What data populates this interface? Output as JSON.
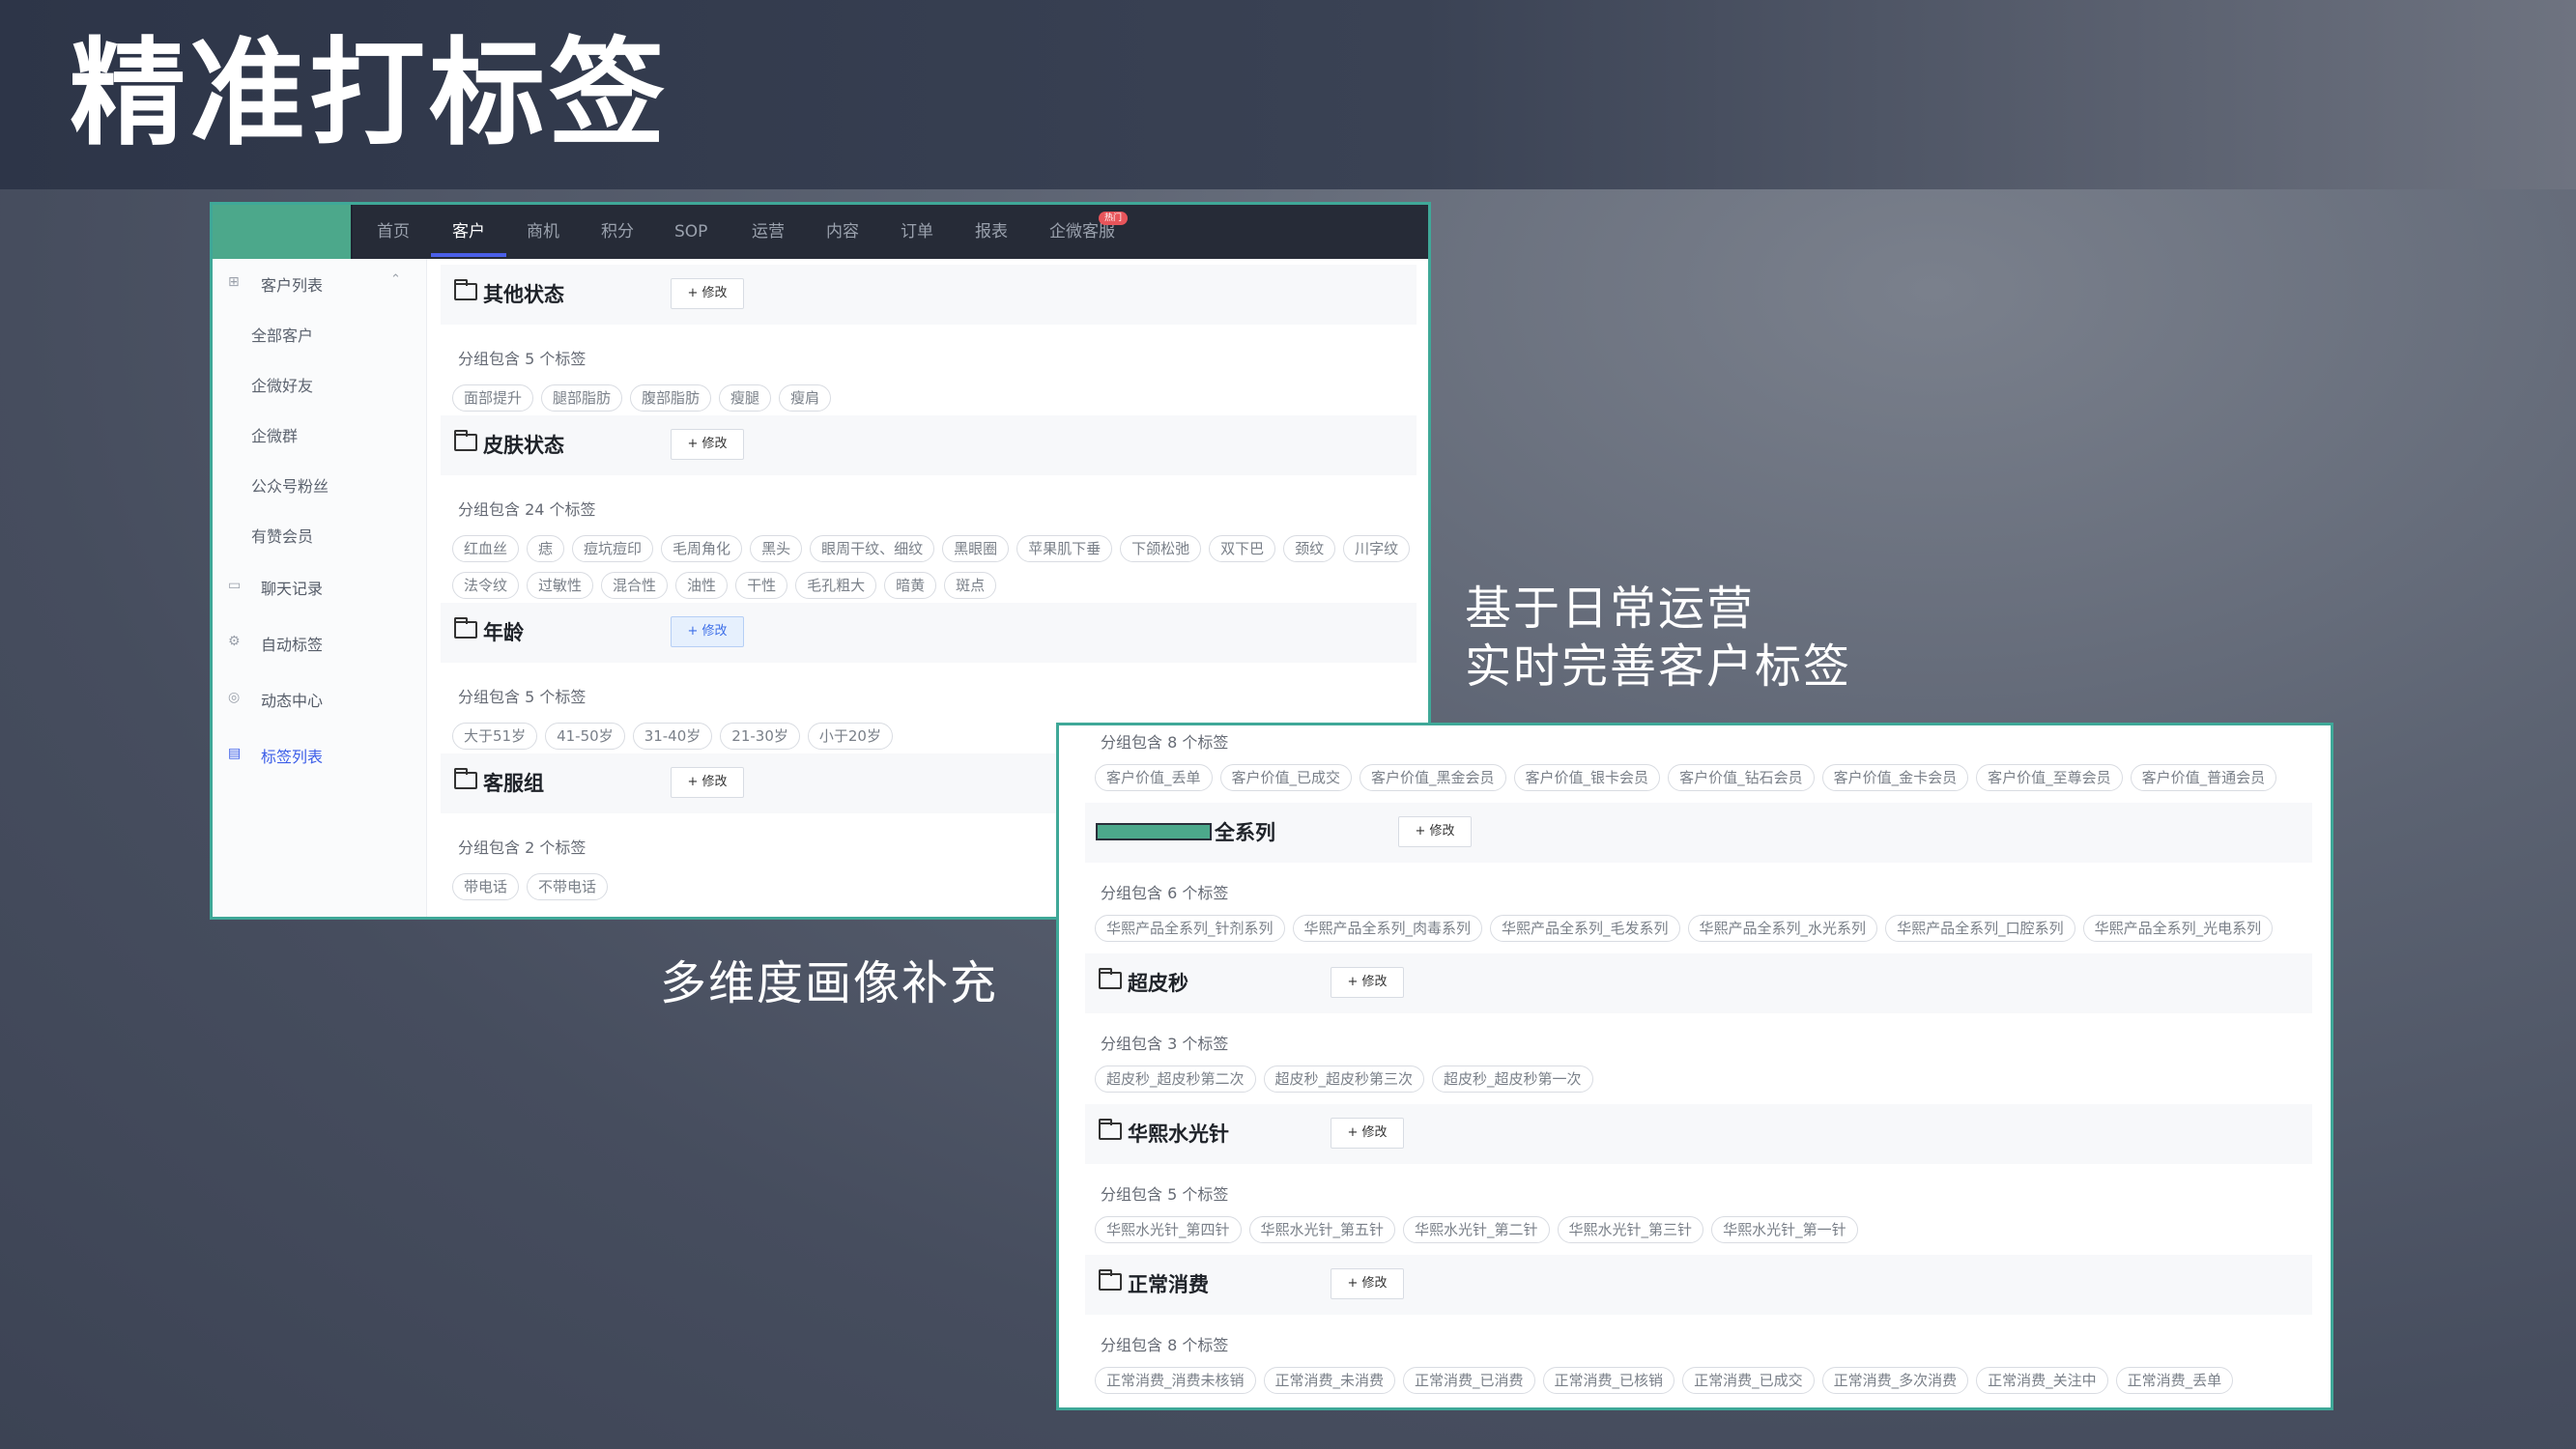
{
  "slide": {
    "title": "精准打标签",
    "caption_right_line1": "基于日常运营",
    "caption_right_line2": "实时完善客户标签",
    "caption_bottom": "多维度画像补充"
  },
  "nav": {
    "items": [
      "首页",
      "客户",
      "商机",
      "积分",
      "SOP",
      "运营",
      "内容",
      "订单",
      "报表",
      "企微客服"
    ],
    "active": "客户",
    "badge": "热门"
  },
  "sidebar": {
    "section": "客户列表",
    "sub_items": [
      "全部客户",
      "企微好友",
      "企微群",
      "公众号粉丝",
      "有赞会员"
    ],
    "main_items": [
      "聊天记录",
      "自动标签",
      "动态中心",
      "标签列表"
    ],
    "active": "标签列表"
  },
  "edit_label": "+ 修改",
  "screen1": {
    "groups": [
      {
        "name": "其他状态",
        "count": "分组包含 5 个标签",
        "tags": [
          "面部提升",
          "腿部脂肪",
          "腹部脂肪",
          "瘦腿",
          "瘦肩"
        ]
      },
      {
        "name": "皮肤状态",
        "count": "分组包含 24 个标签",
        "tags_row1": [
          "红血丝",
          "痣",
          "痘坑痘印",
          "毛周角化",
          "黑头",
          "眼周干纹、细纹",
          "黑眼圈",
          "苹果肌下垂",
          "下颌松弛",
          "双下巴",
          "颈纹",
          "川字纹"
        ],
        "tags_row2": [
          "法令纹",
          "过敏性",
          "混合性",
          "油性",
          "干性",
          "毛孔粗大",
          "暗黄",
          "斑点"
        ]
      },
      {
        "name": "年龄",
        "count": "分组包含 5 个标签",
        "tags": [
          "大于51岁",
          "41-50岁",
          "31-40岁",
          "21-30岁",
          "小于20岁"
        ]
      },
      {
        "name": "客服组",
        "count": "分组包含 2 个标签",
        "tags": [
          "带电话",
          "不带电话"
        ]
      }
    ]
  },
  "screen2": {
    "top_count": "分组包含 8 个标签",
    "top_tags": [
      "客户价值_丢单",
      "客户价值_已成交",
      "客户价值_黑金会员",
      "客户价值_银卡会员",
      "客户价值_钻石会员",
      "客户价值_金卡会员",
      "客户价值_至尊会员",
      "客户价值_普通会员"
    ],
    "groups": [
      {
        "name": "全系列",
        "count": "分组包含 6 个标签",
        "tags": [
          "华熙产品全系列_针剂系列",
          "华熙产品全系列_肉毒系列",
          "华熙产品全系列_毛发系列",
          "华熙产品全系列_水光系列",
          "华熙产品全系列_口腔系列",
          "华熙产品全系列_光电系列"
        ]
      },
      {
        "name": "超皮秒",
        "count": "分组包含 3 个标签",
        "tags": [
          "超皮秒_超皮秒第二次",
          "超皮秒_超皮秒第三次",
          "超皮秒_超皮秒第一次"
        ]
      },
      {
        "name": "华熙水光针",
        "count": "分组包含 5 个标签",
        "tags": [
          "华熙水光针_第四针",
          "华熙水光针_第五针",
          "华熙水光针_第二针",
          "华熙水光针_第三针",
          "华熙水光针_第一针"
        ]
      },
      {
        "name": "正常消费",
        "count": "分组包含 8 个标签",
        "tags": [
          "正常消费_消费未核销",
          "正常消费_未消费",
          "正常消费_已消费",
          "正常消费_已核销",
          "正常消费_已成交",
          "正常消费_多次消费",
          "正常消费_关注中",
          "正常消费_丢单"
        ]
      }
    ]
  }
}
